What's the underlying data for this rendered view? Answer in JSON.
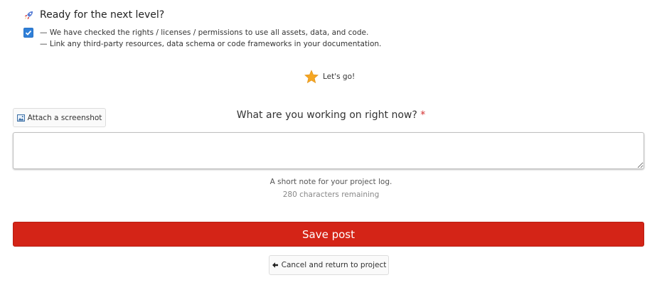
{
  "ready_section": {
    "heading": "Ready for the next level?",
    "icon": "rocket-icon",
    "checkbox_checked": true,
    "lines": [
      "— We have checked the rights / licenses / permissions to use all assets, data, and code.",
      "— Link any third-party resources, data schema or code frameworks in your documentation."
    ]
  },
  "lets_go": {
    "label": "Let's go!",
    "icon": "star-icon",
    "color": "#f5a623"
  },
  "attach": {
    "label": "Attach a screenshot",
    "icon": "image-icon"
  },
  "question": {
    "label": "What are you working on right now?",
    "required_marker": "*"
  },
  "note": {
    "value": "",
    "help": "A short note for your project log.",
    "remaining": "280 characters remaining"
  },
  "save": {
    "label": "Save post",
    "color": "#d42417"
  },
  "cancel": {
    "label": "Cancel and return to project",
    "icon": "arrow-left-icon"
  }
}
